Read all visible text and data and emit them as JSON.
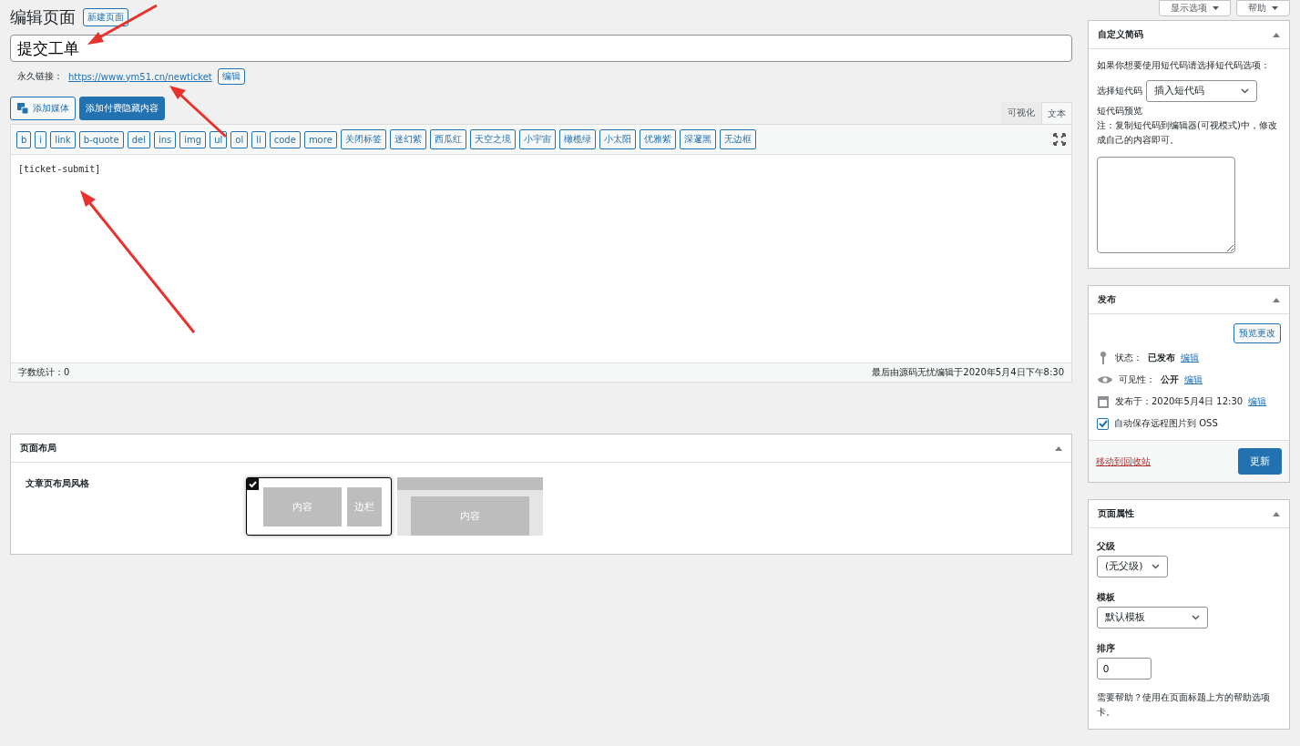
{
  "screen_options": [
    {
      "label": "显示选项"
    },
    {
      "label": "帮助"
    }
  ],
  "heading": "编辑页面",
  "new_page_button": "新建页面",
  "title_field": {
    "value": "提交工单"
  },
  "permalink": {
    "label": "永久链接：",
    "url": "https://www.ym51.cn/newticket",
    "edit": "编辑"
  },
  "media_buttons": [
    {
      "label": "添加媒体",
      "kind": "media"
    },
    {
      "label": "添加付费隐藏内容",
      "kind": "primary"
    }
  ],
  "editor_tabs": [
    {
      "label": "可视化",
      "selected": false
    },
    {
      "label": "文本",
      "selected": true
    }
  ],
  "quicktags": [
    "b",
    "i",
    "link",
    "b-quote",
    "del",
    "ins",
    "img",
    "ul",
    "ol",
    "li",
    "code",
    "more",
    "关闭标签",
    "迷幻紫",
    "西瓜红",
    "天空之境",
    "小宇宙",
    "橄榄绿",
    "小太阳",
    "优雅紫",
    "深邃黑",
    "无边框"
  ],
  "editor_content": "[ticket-submit]",
  "word_count": "字数统计：0",
  "last_edited": "最后由源码无忧编辑于2020年5月4日下午8:30",
  "layout_box": {
    "title": "页面布局",
    "label": "文章页布局风格",
    "options": [
      {
        "kind": "sidebar",
        "selected": true,
        "labels": [
          "内容",
          "边栏"
        ]
      },
      {
        "kind": "full",
        "selected": false,
        "labels": [
          "内容"
        ]
      }
    ]
  },
  "shortcode_box": {
    "title": "自定义简码",
    "intro": "如果你想要使用短代码请选择短代码选项：",
    "select_label": "选择短代码",
    "select_value": "插入短代码",
    "preview_label": "短代码预览",
    "note": "注：复制短代码到编辑器(可视模式)中，修改成自己的内容即可。"
  },
  "publish_box": {
    "title": "发布",
    "preview_button": "预览更改",
    "rows": [
      {
        "kind": "status",
        "label": "状态：",
        "value": "已发布",
        "edit": "编辑"
      },
      {
        "kind": "visibility",
        "label": "可见性：",
        "value": "公开",
        "edit": "编辑"
      },
      {
        "kind": "date",
        "label": "发布于：2020年5月4日 12:30",
        "edit": "编辑"
      }
    ],
    "oss_checkbox": {
      "label": "自动保存远程图片到 OSS",
      "checked": true
    },
    "trash_link": "移动到回收站",
    "update_button": "更新"
  },
  "attributes_box": {
    "title": "页面属性",
    "parent_label": "父级",
    "parent_value": "(无父级)",
    "template_label": "模板",
    "template_value": "默认模板",
    "order_label": "排序",
    "order_value": "0",
    "help": "需要帮助？使用在页面标题上方的帮助选项卡。"
  }
}
